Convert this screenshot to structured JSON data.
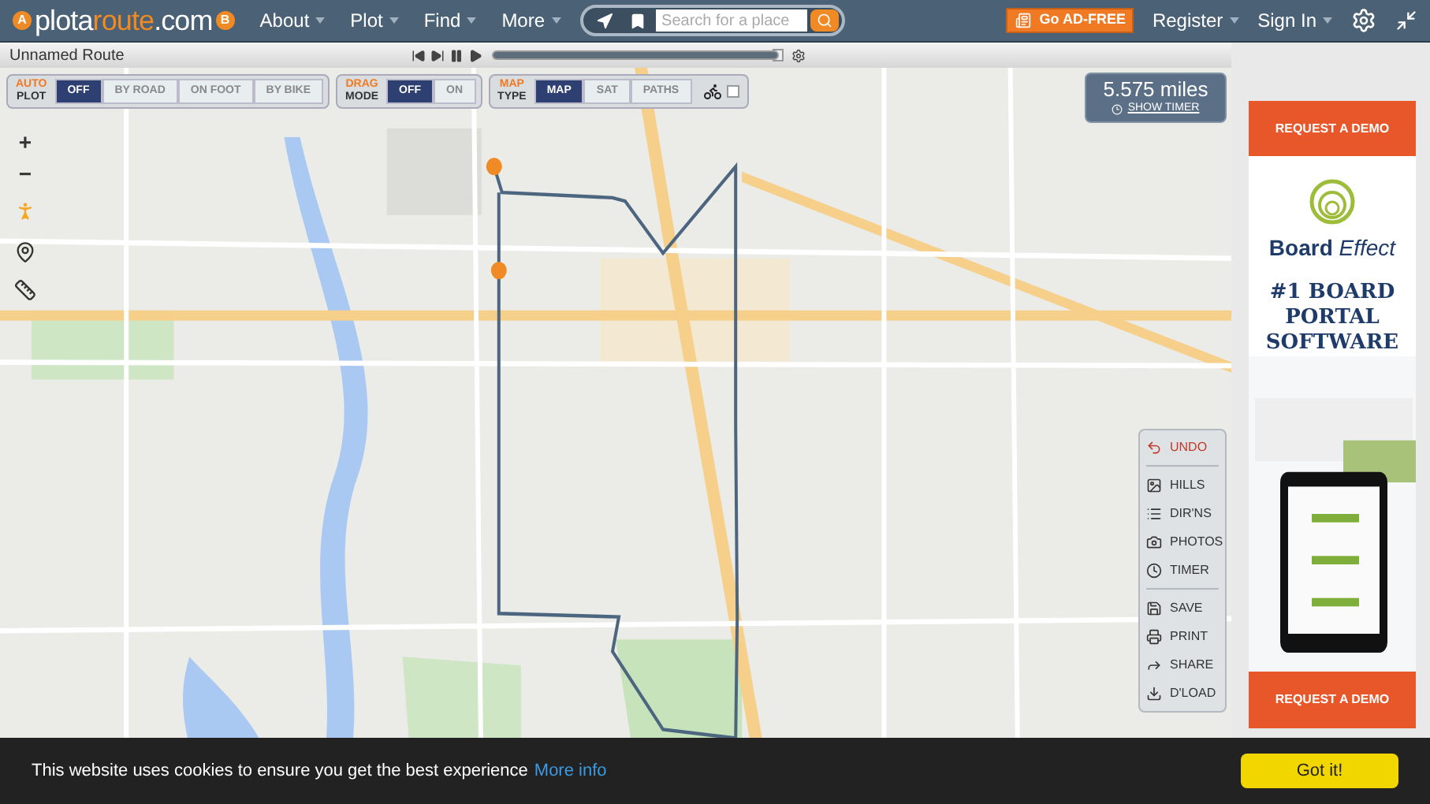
{
  "header": {
    "logo": {
      "pin_left": "A",
      "pin_right": "B",
      "parts": [
        {
          "text": "plota",
          "accent": false
        },
        {
          "text": "route",
          "accent": true
        },
        {
          "text": ".com",
          "accent": false
        }
      ]
    },
    "nav": [
      "About",
      "Plot",
      "Find",
      "More"
    ],
    "search": {
      "placeholder": "Search for a place"
    },
    "ad_free": "Go AD-FREE",
    "account": [
      "Register",
      "Sign In"
    ]
  },
  "route_bar": {
    "title": "Unnamed Route",
    "progress": {
      "level": 1
    }
  },
  "map_controls": [
    {
      "top": "AUTO",
      "bottom": "PLOT",
      "options": [
        {
          "label": "OFF",
          "selected": true
        },
        {
          "label": "BY ROAD",
          "selected": false
        },
        {
          "label": "ON FOOT",
          "selected": false
        },
        {
          "label": "BY BIKE",
          "selected": false
        }
      ]
    },
    {
      "top": "DRAG",
      "bottom": "MODE",
      "options": [
        {
          "label": "OFF",
          "selected": true
        },
        {
          "label": "ON",
          "selected": false
        }
      ]
    },
    {
      "top": "MAP",
      "bottom": "TYPE",
      "options": [
        {
          "label": "MAP",
          "selected": true
        },
        {
          "label": "SAT",
          "selected": false
        },
        {
          "label": "PATHS",
          "selected": false
        }
      ],
      "bike_layer": {
        "checked": false
      }
    }
  ],
  "zoom": [
    "+",
    "−"
  ],
  "distance": {
    "value": "5.575 miles",
    "timer_link": "SHOW TIMER"
  },
  "tools": [
    [
      {
        "label": "UNDO",
        "kind": "undo"
      }
    ],
    [
      {
        "label": "HILLS",
        "kind": "hills"
      },
      {
        "label": "DIR'NS",
        "kind": "list"
      },
      {
        "label": "PHOTOS",
        "kind": "camera"
      },
      {
        "label": "TIMER",
        "kind": "clock"
      }
    ],
    [
      {
        "label": "SAVE",
        "kind": "save"
      },
      {
        "label": "PRINT",
        "kind": "print"
      },
      {
        "label": "SHARE",
        "kind": "share"
      },
      {
        "label": "D'LOAD",
        "kind": "download"
      }
    ]
  ],
  "ad": {
    "top_button": "REQUEST A DEMO",
    "brand": [
      "Board",
      "Effect"
    ],
    "headline": "#1 BOARD PORTAL SOFTWARE",
    "bottom_button": "REQUEST A DEMO"
  },
  "cookie_bar": {
    "message": "This website uses cookies to ensure you get the best experience",
    "link": "More info",
    "button": "Got it!"
  }
}
